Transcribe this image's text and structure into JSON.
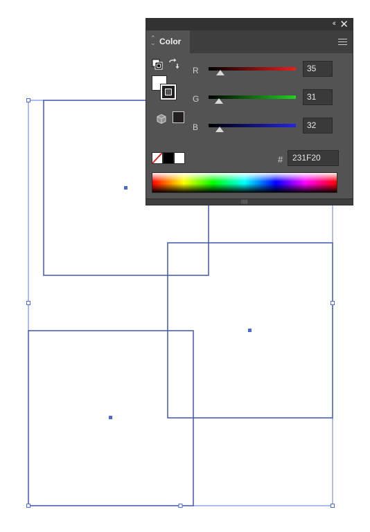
{
  "panel": {
    "title": "Color",
    "collapse_glyph": "‹‹",
    "close_glyph": "✕",
    "tab_arrows": "⌃⌄",
    "channels": [
      {
        "name": "R",
        "value": "35",
        "level": 0.137,
        "gradient_end": "#e81f1f"
      },
      {
        "name": "G",
        "value": "31",
        "level": 0.122,
        "gradient_end": "#1fd21f"
      },
      {
        "name": "B",
        "value": "32",
        "level": 0.125,
        "gradient_end": "#2424e0"
      }
    ],
    "hash_label": "#",
    "hex_value": "231F20",
    "grip": "||||||"
  },
  "icons": {
    "default_colors": "default-fill-stroke-icon",
    "swap": "swap-fill-stroke-icon",
    "fill": "fill-swatch-icon",
    "stroke": "stroke-swatch-icon",
    "cube": "cube-icon",
    "last_color": "last-color-swatch-icon",
    "none": "none-swatch-icon",
    "black": "black-swatch-icon",
    "white": "white-swatch-icon",
    "menu": "panel-menu-icon"
  },
  "colors": {
    "selection": "#4a68d6",
    "artwork_stroke": "#2a3c8f",
    "panel_bg": "#535353",
    "current_color": "#231f20"
  }
}
